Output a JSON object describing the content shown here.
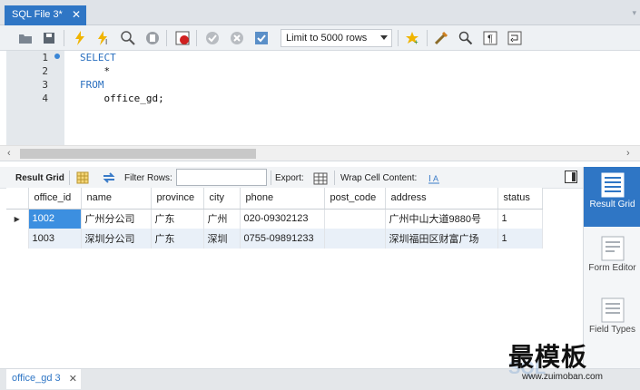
{
  "tabs": {
    "query_tab": "SQL File 3*",
    "close": "✕",
    "dropdown": "▾"
  },
  "toolbar": {
    "limit_select": "Limit to 5000 rows",
    "icons": [
      "open-folder-icon",
      "save-icon",
      "execute-icon",
      "execute-current-icon",
      "explain-icon",
      "stop-icon",
      "toggle-error-icon",
      "commit-icon",
      "rollback-icon",
      "autocommit-icon",
      "bookmark-icon",
      "beautify-icon",
      "find-icon",
      "invisible-chars-icon",
      "wrap-icon"
    ]
  },
  "editor": {
    "line_numbers": [
      "1",
      "2",
      "3",
      "4"
    ],
    "lines": [
      {
        "text": "SELECT",
        "kind": "keyword"
      },
      {
        "text": "    *",
        "kind": "plain"
      },
      {
        "text": "FROM",
        "kind": "keyword"
      },
      {
        "text": "    office_gd;",
        "kind": "plain"
      }
    ],
    "keyword_color": "#2a6fbf"
  },
  "result_toolbar": {
    "result_grid": "Result Grid",
    "filter_rows": "Filter Rows:",
    "export": "Export:",
    "wrap_cell": "Wrap Cell Content:"
  },
  "grid": {
    "columns": [
      "office_id",
      "name",
      "province",
      "city",
      "phone",
      "post_code",
      "address",
      "status"
    ],
    "rows": [
      [
        "1002",
        "广州分公司",
        "广东",
        "广州",
        "020-09302123",
        "",
        "广州中山大道9880号",
        "1"
      ],
      [
        "1003",
        "深圳分公司",
        "广东",
        "深圳",
        "0755-09891233",
        "",
        "深圳福田区财富广场",
        "1"
      ]
    ],
    "current_row_marker": "▶",
    "selection_color": "#3c8fe0"
  },
  "side_panel": {
    "result_grid": "Result Grid",
    "form_editor": "Form Editor",
    "field_types": "Field Types"
  },
  "bottom_tab": {
    "label": "office_gd 3",
    "close": "✕"
  },
  "watermark": {
    "text": "最模板",
    "url": "www.zuimoban.com"
  },
  "colors": {
    "accent": "#2f76c5"
  }
}
